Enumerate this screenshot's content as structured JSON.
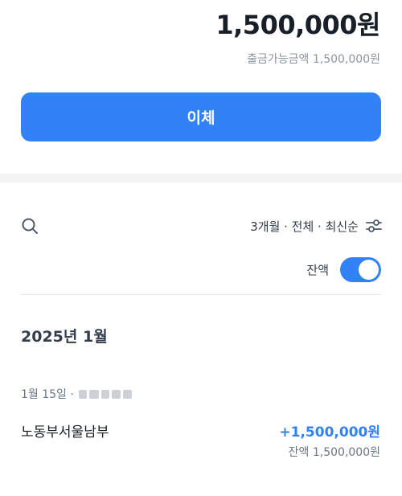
{
  "balance": {
    "amount": "1,500,000원",
    "withdrawable": "출금가능금액 1,500,000원",
    "transfer_label": "이체"
  },
  "filter": {
    "summary": "3개월 · 전체 · 최신순",
    "balance_toggle_label": "잔액",
    "balance_toggle_on": true,
    "icons": [
      "search-icon",
      "filter-sliders-icon"
    ]
  },
  "transactions": {
    "month": "2025년 1월",
    "items": [
      {
        "date": "1월 15일 ·",
        "title": "노동부서울남부",
        "amount": "+1,500,000원",
        "balance": "잔액 1,500,000원"
      }
    ]
  },
  "colors": {
    "accent": "#3182f6",
    "text_primary": "#191f28",
    "text_secondary": "#8b95a1",
    "divider": "#f2f4f6"
  }
}
